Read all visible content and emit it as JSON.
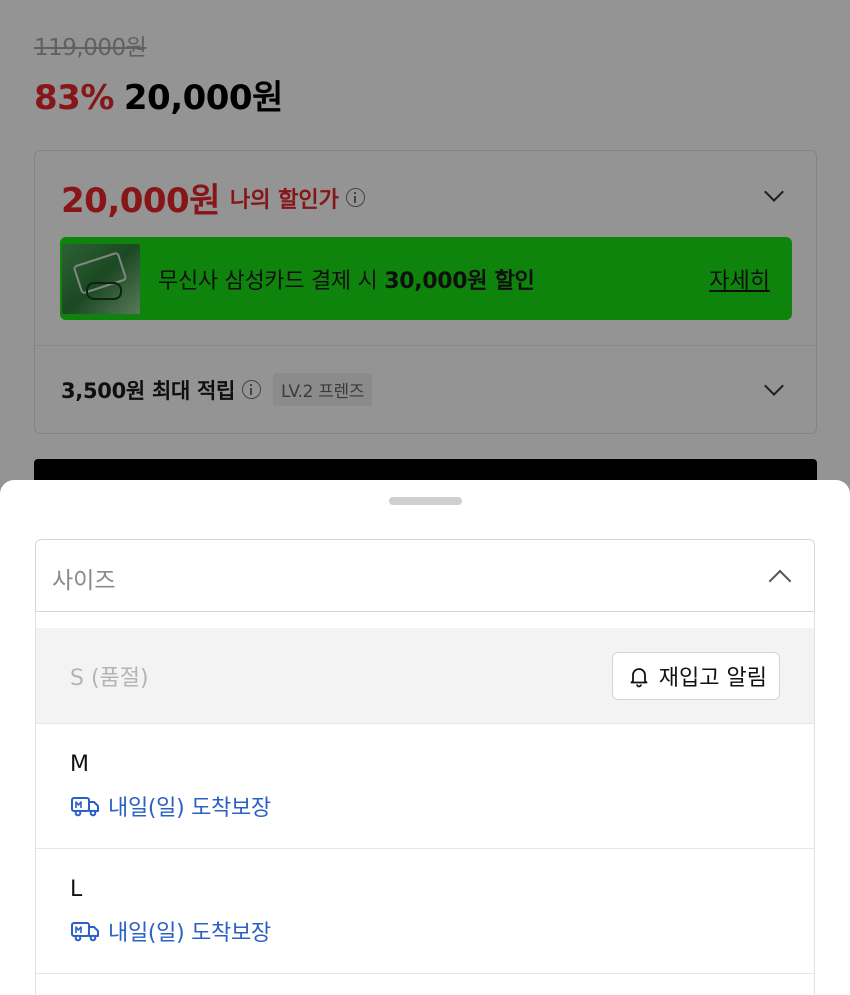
{
  "product": {
    "original_price": "119,000원",
    "discount_rate": "83%",
    "sale_price": "20,000원"
  },
  "benefits": {
    "my_price": "20,000원",
    "my_price_label": "나의 할인가",
    "card_banner": {
      "text_prefix": "무신사 삼성카드 결제 시 ",
      "text_bold": "30,000원 할인",
      "link": "자세히",
      "background_color": "#1be316"
    },
    "points": "3,500원 최대 적립",
    "level_tag": "LV.2 프렌즈"
  },
  "sheet": {
    "select_label": "사이즈",
    "options": [
      {
        "name": "S (품절)",
        "soldout": true,
        "action": "재입고 알림"
      },
      {
        "name": "M",
        "delivery": "내일(일) 도착보장"
      },
      {
        "name": "L",
        "delivery": "내일(일) 도착보장"
      }
    ]
  },
  "colors": {
    "accent_red": "#e8262a",
    "delivery_blue": "#2b61c6"
  }
}
